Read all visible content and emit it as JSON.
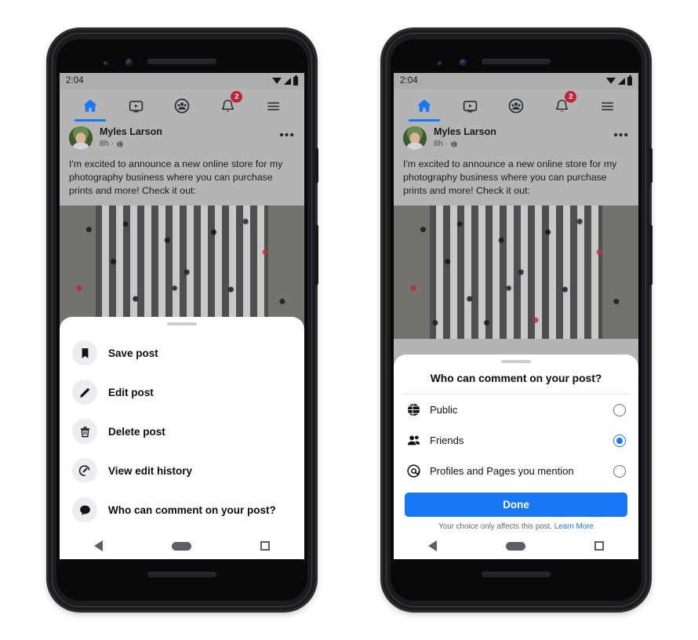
{
  "statusbar": {
    "time": "2:04",
    "icons": [
      "wifi-icon",
      "signal-icon",
      "battery-icon"
    ]
  },
  "topnav": {
    "items": [
      {
        "name": "home-tab",
        "icon": "home-icon",
        "active": true
      },
      {
        "name": "video-tab",
        "icon": "video-icon",
        "active": false
      },
      {
        "name": "groups-tab",
        "icon": "groups-icon",
        "active": false
      },
      {
        "name": "notifications-tab",
        "icon": "bell-icon",
        "active": false,
        "badge": "2"
      },
      {
        "name": "menu-tab",
        "icon": "hamburger-icon",
        "active": false
      }
    ]
  },
  "post": {
    "author": "Myles Larson",
    "time": "8h",
    "separator": "·",
    "audience_icon": "globe-icon",
    "more_icon": "•••",
    "body": "I'm excited to announce a new online store for my photography business where you can purchase prints and more! Check it out:",
    "image_alt": "aerial-crosswalk-photo"
  },
  "left_sheet": {
    "menu": [
      {
        "label": "Save post",
        "icon": "bookmark-icon"
      },
      {
        "label": "Edit post",
        "icon": "pencil-icon"
      },
      {
        "label": "Delete post",
        "icon": "trash-icon"
      },
      {
        "label": "View edit history",
        "icon": "edit-history-icon"
      },
      {
        "label": "Who can comment on your post?",
        "icon": "comment-icon"
      }
    ]
  },
  "right_sheet": {
    "title": "Who can comment on your post?",
    "options": [
      {
        "label": "Public",
        "icon": "globe-icon",
        "selected": false
      },
      {
        "label": "Friends",
        "icon": "friends-icon",
        "selected": true
      },
      {
        "label": "Profiles and Pages you mention",
        "icon": "at-icon",
        "selected": false
      }
    ],
    "done_label": "Done",
    "footer_text": "Your choice only affects this post.",
    "footer_link": "Learn More"
  },
  "androidnav": {
    "back": "back-icon",
    "home": "home-pill-icon",
    "recent": "recents-icon"
  },
  "colors": {
    "accent": "#1877f2",
    "badge": "#c32338",
    "screen_bg": "#b4b4b4",
    "sheet_bg": "#ffffff"
  }
}
